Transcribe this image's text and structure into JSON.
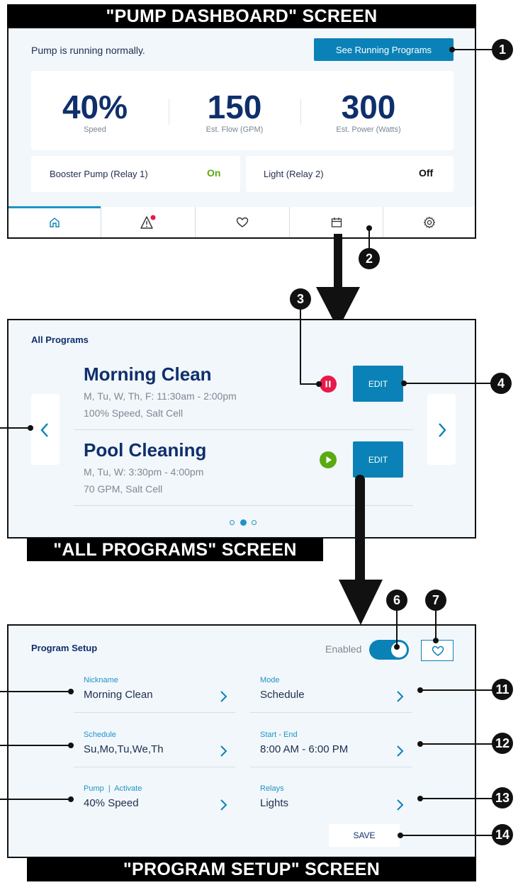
{
  "banners": {
    "dashboard": "\"PUMP DASHBOARD\" SCREEN",
    "all_programs": "\"ALL PROGRAMS\" SCREEN",
    "program_setup": "\"PROGRAM SETUP\" SCREEN"
  },
  "dashboard": {
    "status": "Pump is running normally.",
    "running_button": "See Running Programs",
    "metrics": [
      {
        "value": "40%",
        "label": "Speed"
      },
      {
        "value": "150",
        "label": "Est. Flow (GPM)"
      },
      {
        "value": "300",
        "label": "Est. Power (Watts)"
      }
    ],
    "relays": [
      {
        "label": "Booster Pump (Relay 1)",
        "state": "On",
        "color": "#5aaa12"
      },
      {
        "label": "Light (Relay 2)",
        "state": "Off",
        "color": "#111111"
      }
    ],
    "tabs": [
      "home-icon",
      "alert-icon",
      "heart-icon",
      "calendar-icon",
      "gear-icon"
    ],
    "accent": "#0a82b7",
    "alert_badge_color": "#e8194a"
  },
  "all_programs": {
    "title": "All Programs",
    "programs": [
      {
        "name": "Morning Clean",
        "schedule": "M, Tu, W, Th, F: 11:30am - 2:00pm",
        "details": "100% Speed, Salt Cell",
        "state_icon": "pause-icon",
        "state_color": "#e8194a",
        "edit": "EDIT"
      },
      {
        "name": "Pool Cleaning",
        "schedule": "M, Tu, W: 3:30pm - 4:00pm",
        "details": "70 GPM, Salt Cell",
        "state_icon": "play-icon",
        "state_color": "#5aaa12",
        "edit": "EDIT"
      }
    ],
    "page_count": 3,
    "current_page": 2
  },
  "program_setup": {
    "title": "Program Setup",
    "enabled_label": "Enabled",
    "enabled": true,
    "fields": [
      {
        "label": "Nickname",
        "value": "Morning Clean"
      },
      {
        "label": "Mode",
        "value": "Schedule"
      },
      {
        "label": "Schedule",
        "value": "Su,Mo,Tu,We,Th"
      },
      {
        "label": "Start - End",
        "value": "8:00 AM - 6:00 PM"
      },
      {
        "label": "Pump  |  Activate",
        "value": "40% Speed"
      },
      {
        "label": "Relays",
        "value": "Lights"
      }
    ],
    "save": "SAVE"
  },
  "callouts": [
    "1",
    "2",
    "3",
    "4",
    "6",
    "7",
    "11",
    "12",
    "13",
    "14"
  ]
}
